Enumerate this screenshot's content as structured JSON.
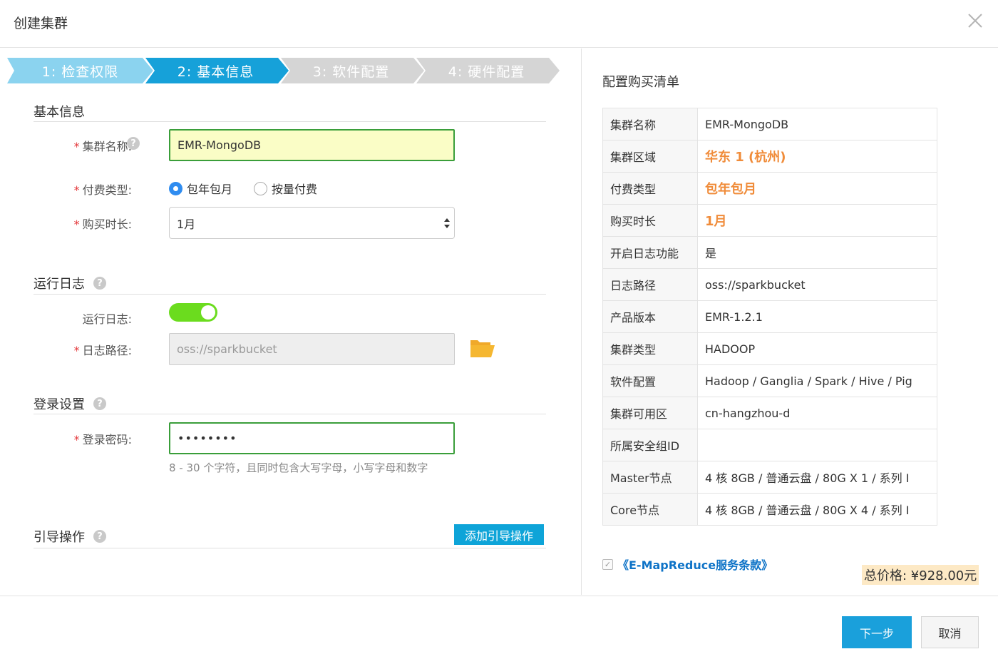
{
  "dialog": {
    "title": "创建集群"
  },
  "steps": [
    {
      "label": "1:  检查权限",
      "state": "done"
    },
    {
      "label": "2:  基本信息",
      "state": "active"
    },
    {
      "label": "3:  软件配置",
      "state": "pending"
    },
    {
      "label": "4:  硬件配置",
      "state": "pending"
    }
  ],
  "basic": {
    "section_title": "基本信息",
    "cluster_name_label": "集群名称:",
    "cluster_name_value": "EMR-MongoDB",
    "pay_type_label": "付费类型:",
    "pay_options": [
      "包年包月",
      "按量付费"
    ],
    "pay_selected": "包年包月",
    "duration_label": "购买时长:",
    "duration_value": "1月"
  },
  "log": {
    "section_title": "运行日志",
    "toggle_label": "运行日志:",
    "toggle_on": true,
    "path_label": "日志路径:",
    "path_value": "oss://sparkbucket"
  },
  "login": {
    "section_title": "登录设置",
    "password_label": "登录密码:",
    "password_value": "••••••••",
    "hint": "8 - 30 个字符，且同时包含大写字母，小写字母和数字"
  },
  "bootstrap": {
    "section_title": "引导操作",
    "add_button": "添加引导操作"
  },
  "required_mark": "*",
  "help_glyph": "?",
  "summary": {
    "title": "配置购买清单",
    "rows": [
      {
        "k": "集群名称",
        "v": "EMR-MongoDB",
        "hl": false
      },
      {
        "k": "集群区域",
        "v": "华东 1 (杭州)",
        "hl": true
      },
      {
        "k": "付费类型",
        "v": "包年包月",
        "hl": true
      },
      {
        "k": "购买时长",
        "v": "1月",
        "hl": true
      },
      {
        "k": "开启日志功能",
        "v": "是",
        "hl": false
      },
      {
        "k": "日志路径",
        "v": "oss://sparkbucket",
        "hl": false
      },
      {
        "k": "产品版本",
        "v": "EMR-1.2.1",
        "hl": false
      },
      {
        "k": "集群类型",
        "v": "HADOOP",
        "hl": false
      },
      {
        "k": "软件配置",
        "v": "Hadoop / Ganglia / Spark / Hive / Pig",
        "hl": false
      },
      {
        "k": "集群可用区",
        "v": "cn-hangzhou-d",
        "hl": false
      },
      {
        "k": "所属安全组ID",
        "v": "",
        "hl": false
      },
      {
        "k": "Master节点",
        "v": "4 核 8GB / 普通云盘 / 80G X 1 / 系列 I",
        "hl": false
      },
      {
        "k": "Core节点",
        "v": "4 核 8GB / 普通云盘 / 80G X 4 / 系列 I",
        "hl": false
      }
    ],
    "agreement": "《E-MapReduce服务条款》",
    "agreement_checked": true,
    "total": "总价格: ¥928.00元"
  },
  "footer": {
    "next": "下一步",
    "cancel": "取消"
  },
  "colors": {
    "step_done": "#8bd3ef",
    "step_active": "#16a1d9",
    "step_pending": "#d5d5d5",
    "highlight": "#f08c3a",
    "toggle_on": "#6bdc1e",
    "primary_button": "#1aa0db"
  }
}
